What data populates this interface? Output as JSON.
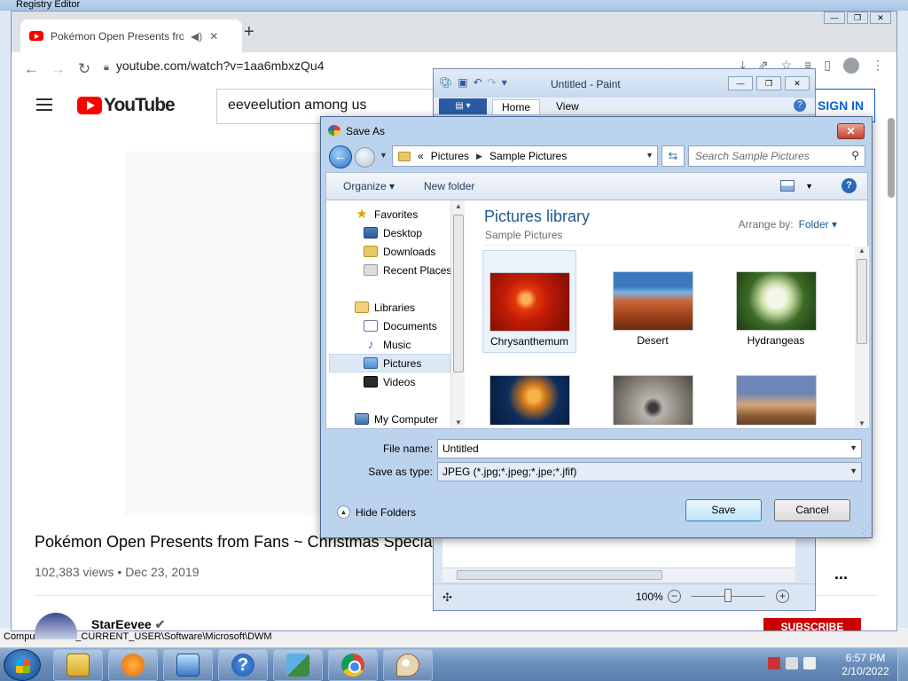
{
  "regedit": {
    "title": "Registry Editor",
    "status": "Computer\\HKEY_CURRENT_USER\\Software\\Microsoft\\DWM"
  },
  "chrome": {
    "tab_title": "Pokémon Open Presents fro",
    "url": "youtube.com/watch?v=1aa6mbxzQu4",
    "youtube": {
      "logo_text": "YouTube",
      "search_value": "eeveelution among us",
      "sign_in": "SIGN IN",
      "video_title": "Pokémon Open Presents from Fans ~ Christmas Special",
      "views": "102,383 views",
      "date": "Dec 23, 2019",
      "channel": "StarEevee",
      "subscribe": "SUBSCRIBE",
      "more": "..."
    }
  },
  "paint": {
    "title": "Untitled - Paint",
    "tabs": [
      "Home",
      "View"
    ],
    "zoom": "100%",
    "zoom_level_percent": 100
  },
  "dialog": {
    "title": "Save As",
    "breadcrumb": [
      "Pictures",
      "Sample Pictures"
    ],
    "breadcrumb_prefix": "«",
    "search_placeholder": "Search Sample Pictures",
    "organize": "Organize",
    "new_folder": "New folder",
    "nav": {
      "favorites": "Favorites",
      "desktop": "Desktop",
      "downloads": "Downloads",
      "recent": "Recent Places",
      "libraries": "Libraries",
      "documents": "Documents",
      "music": "Music",
      "pictures": "Pictures",
      "videos": "Videos",
      "computer": "My Computer"
    },
    "library_title": "Pictures library",
    "library_sub": "Sample Pictures",
    "arrange_label": "Arrange by:",
    "arrange_value": "Folder",
    "thumbnails": [
      {
        "name": "Chrysanthemum",
        "selected": true
      },
      {
        "name": "Desert",
        "selected": false
      },
      {
        "name": "Hydrangeas",
        "selected": false
      },
      {
        "name": "",
        "selected": false
      },
      {
        "name": "",
        "selected": false
      },
      {
        "name": "",
        "selected": false
      }
    ],
    "file_name_label": "File name:",
    "file_name_value": "Untitled",
    "save_type_label": "Save as type:",
    "save_type_value": "JPEG (*.jpg;*.jpeg;*.jpe;*.jfif)",
    "hide_folders": "Hide Folders",
    "save": "Save",
    "cancel": "Cancel"
  },
  "taskbar": {
    "time": "6:57 PM",
    "date": "2/10/2022"
  }
}
